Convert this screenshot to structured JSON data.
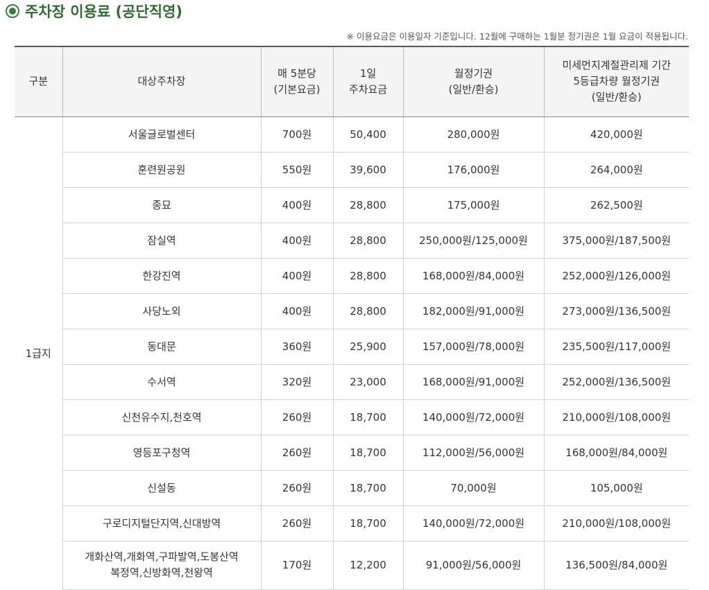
{
  "page": {
    "title": "주차장 이용료 (공단직영)",
    "note": "※ 이용요금은 이용일자 기준입니다. 12월에 구매하는 1월분 정기권은 1월 요금이 적용됩니다."
  },
  "table": {
    "headers": [
      {
        "lines": [
          "구분"
        ]
      },
      {
        "lines": [
          "대상주차장"
        ]
      },
      {
        "lines": [
          "매 5분당",
          "(기본요금)"
        ]
      },
      {
        "lines": [
          "1일",
          "주차요금"
        ]
      },
      {
        "lines": [
          "월정기권",
          "(일반/환승)"
        ]
      },
      {
        "lines": [
          "미세먼지계절관리제 기간",
          "5등급차량 월정기권",
          "(일반/환승)"
        ]
      }
    ],
    "grade": "1급지",
    "rows": [
      {
        "lot": [
          "서울글로벌센터"
        ],
        "fee5": "700원",
        "daily": "50,400",
        "monthly": "280,000원",
        "dust": "420,000원"
      },
      {
        "lot": [
          "훈련원공원"
        ],
        "fee5": "550원",
        "daily": "39,600",
        "monthly": "176,000원",
        "dust": "264,000원"
      },
      {
        "lot": [
          "종묘"
        ],
        "fee5": "400원",
        "daily": "28,800",
        "monthly": "175,000원",
        "dust": "262,500원"
      },
      {
        "lot": [
          "잠실역"
        ],
        "fee5": "400원",
        "daily": "28,800",
        "monthly": "250,000원/125,000원",
        "dust": "375,000원/187,500원"
      },
      {
        "lot": [
          "한강진역"
        ],
        "fee5": "400원",
        "daily": "28,800",
        "monthly": "168,000원/84,000원",
        "dust": "252,000원/126,000원"
      },
      {
        "lot": [
          "사당노외"
        ],
        "fee5": "400원",
        "daily": "28,800",
        "monthly": "182,000원/91,000원",
        "dust": "273,000원/136,500원"
      },
      {
        "lot": [
          "동대문"
        ],
        "fee5": "360원",
        "daily": "25,900",
        "monthly": "157,000원/78,000원",
        "dust": "235,500원/117,000원"
      },
      {
        "lot": [
          "수서역"
        ],
        "fee5": "320원",
        "daily": "23,000",
        "monthly": "168,000원/91,000원",
        "dust": "252,000원/136,500원"
      },
      {
        "lot": [
          "신천유수지,천호역"
        ],
        "fee5": "260원",
        "daily": "18,700",
        "monthly": "140,000원/72,000원",
        "dust": "210,000원/108,000원"
      },
      {
        "lot": [
          "영등포구청역"
        ],
        "fee5": "260원",
        "daily": "18,700",
        "monthly": "112,000원/56,000원",
        "dust": "168,000원/84,000원"
      },
      {
        "lot": [
          "신설동"
        ],
        "fee5": "260원",
        "daily": "18,700",
        "monthly": "70,000원",
        "dust": "105,000원"
      },
      {
        "lot": [
          "구로디지털단지역,신대방역"
        ],
        "fee5": "260원",
        "daily": "18,700",
        "monthly": "140,000원/72,000원",
        "dust": "210,000원/108,000원"
      },
      {
        "lot": [
          "개화산역,개화역,구파발역,도봉산역",
          "복정역,신방화역,천왕역"
        ],
        "fee5": "170원",
        "daily": "12,200",
        "monthly": "91,000원/56,000원",
        "dust": "136,500원/84,000원"
      }
    ]
  }
}
